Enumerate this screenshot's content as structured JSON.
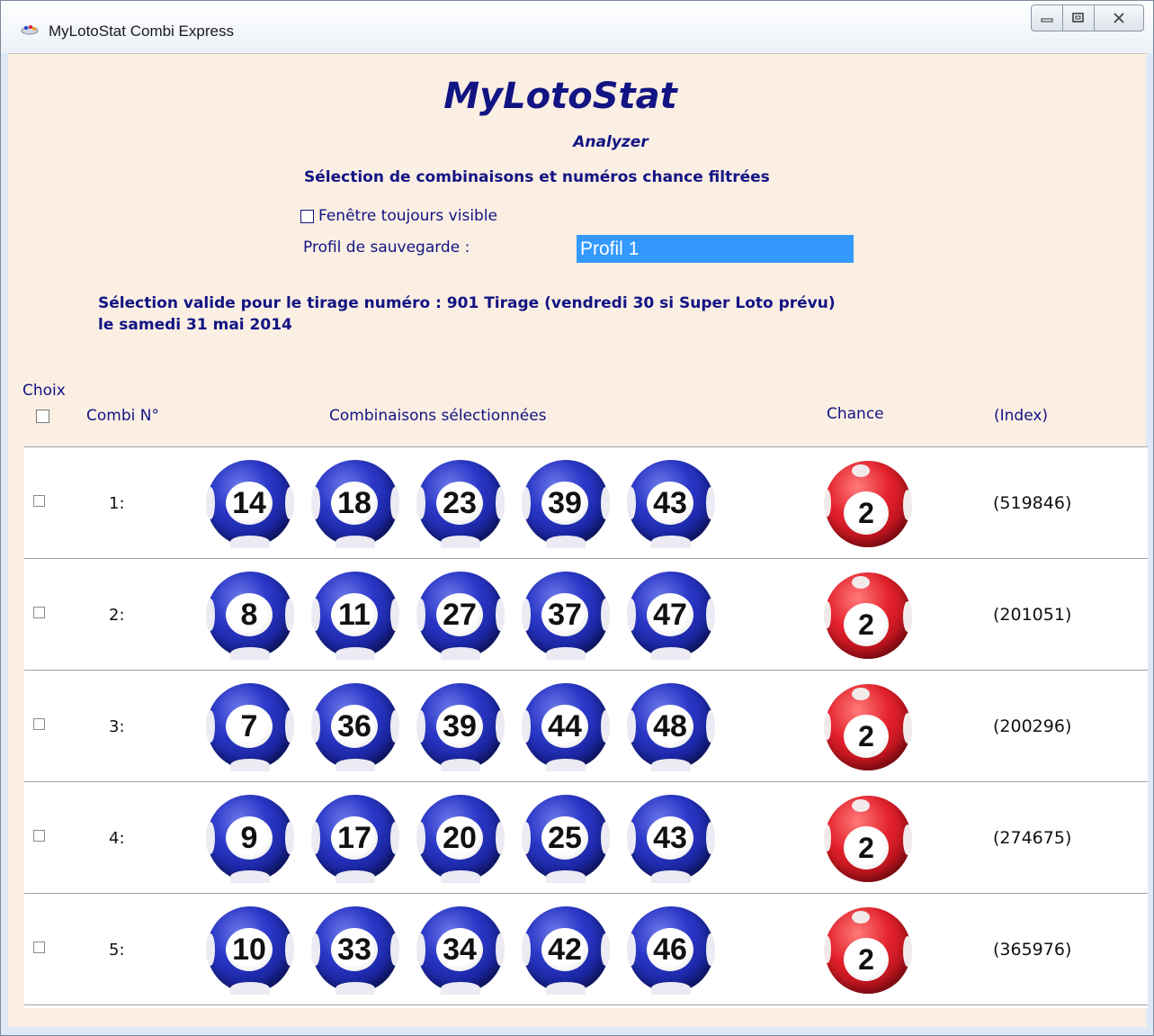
{
  "window": {
    "title": "MyLotoStat Combi Express",
    "buttons": [
      "minimize",
      "maximize",
      "close"
    ]
  },
  "brand": {
    "title": "MyLotoStat",
    "subtitle": "Analyzer"
  },
  "heading": "Sélection de combinaisons et numéros chance filtrées",
  "always_visible": {
    "label": "Fenêtre toujours visible",
    "checked": false
  },
  "profile": {
    "label": "Profil de sauvegarde :",
    "value": "Profil 1"
  },
  "validity": {
    "line1": "Sélection valide pour le tirage numéro : 901 Tirage (vendredi 30 si Super Loto prévu)",
    "line2": "le samedi  31 mai 2014"
  },
  "columns": {
    "choix": "Choix",
    "combi": "Combi N°",
    "combinations": "Combinaisons  sélectionnées",
    "chance": "Chance",
    "index": "(Index)"
  },
  "rows": [
    {
      "num": "1:",
      "balls": [
        "14",
        "18",
        "23",
        "39",
        "43"
      ],
      "chance": "2",
      "index": "(519846)"
    },
    {
      "num": "2:",
      "balls": [
        "8",
        "11",
        "27",
        "37",
        "47"
      ],
      "chance": "2",
      "index": "(201051)"
    },
    {
      "num": "3:",
      "balls": [
        "7",
        "36",
        "39",
        "44",
        "48"
      ],
      "chance": "2",
      "index": "(200296)"
    },
    {
      "num": "4:",
      "balls": [
        "9",
        "17",
        "20",
        "25",
        "43"
      ],
      "chance": "2",
      "index": "(274675)"
    },
    {
      "num": "5:",
      "balls": [
        "10",
        "33",
        "34",
        "42",
        "46"
      ],
      "chance": "2",
      "index": "(365976)"
    }
  ],
  "colors": {
    "brand_blue": "#121483",
    "ball_blue": "#2b38c8",
    "chance_red": "#e3212b",
    "background": "#fbeee3",
    "selection": "#3399ff"
  }
}
